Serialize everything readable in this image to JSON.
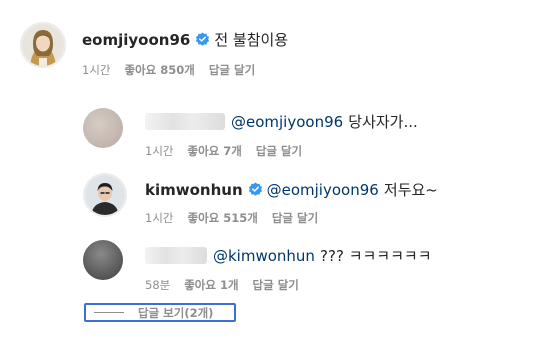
{
  "comment": {
    "username": "eomjiyoon96",
    "text": "전 불참이용",
    "time": "1시간",
    "likes": "좋아요 850개",
    "reply": "답글 달기"
  },
  "replies": [
    {
      "username": "",
      "mention": "@eomjiyoon96",
      "text": "당사자가...",
      "time": "1시간",
      "likes": "좋아요 7개",
      "reply": "답글 달기"
    },
    {
      "username": "kimwonhun",
      "mention": "@eomjiyoon96",
      "text": "저두요~",
      "time": "1시간",
      "likes": "좋아요 515개",
      "reply": "답글 달기"
    },
    {
      "username": "",
      "mention": "@kimwonhun",
      "text": "??? ㅋㅋㅋㅋㅋㅋ",
      "time": "58분",
      "likes": "좋아요 1개",
      "reply": "답글 달기"
    }
  ],
  "view_replies_label": "답글 보기(2개)",
  "colors": {
    "verified": "#3897f0",
    "mention": "#00376b",
    "meta": "#8e8e8e"
  }
}
